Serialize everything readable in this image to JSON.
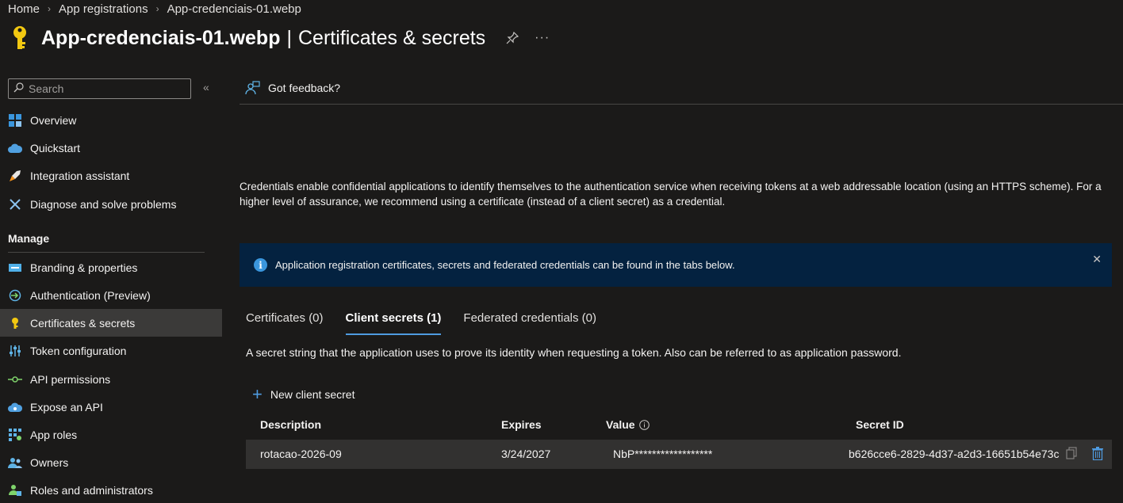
{
  "breadcrumb": {
    "home": "Home",
    "app_registrations": "App registrations",
    "current": "App-credenciais-01.webp"
  },
  "header": {
    "title_main": "App-credenciais-01.webp",
    "title_sep": "|",
    "title_sub": "Certificates & secrets",
    "more": "···"
  },
  "search": {
    "placeholder": "Search"
  },
  "sidebar": {
    "items": [
      {
        "label": "Overview"
      },
      {
        "label": "Quickstart"
      },
      {
        "label": "Integration assistant"
      },
      {
        "label": "Diagnose and solve problems"
      }
    ],
    "section_manage": "Manage",
    "manage_items": [
      {
        "label": "Branding & properties"
      },
      {
        "label": "Authentication (Preview)"
      },
      {
        "label": "Certificates & secrets"
      },
      {
        "label": "Token configuration"
      },
      {
        "label": "API permissions"
      },
      {
        "label": "Expose an API"
      },
      {
        "label": "App roles"
      },
      {
        "label": "Owners"
      },
      {
        "label": "Roles and administrators"
      }
    ]
  },
  "main": {
    "feedback": "Got feedback?",
    "description": "Credentials enable confidential applications to identify themselves to the authentication service when receiving tokens at a web addressable location (using an HTTPS scheme). For a higher level of assurance, we recommend using a certificate (instead of a client secret) as a credential.",
    "banner": "Application registration certificates, secrets and federated credentials can be found in the tabs below.",
    "tabs": [
      {
        "label": "Certificates (0)"
      },
      {
        "label": "Client secrets (1)"
      },
      {
        "label": "Federated credentials (0)"
      }
    ],
    "tab_description": "A secret string that the application uses to prove its identity when requesting a token. Also can be referred to as application password.",
    "new_secret": "New client secret",
    "table": {
      "headers": {
        "description": "Description",
        "expires": "Expires",
        "value": "Value",
        "secret_id": "Secret ID"
      },
      "rows": [
        {
          "description": "rotacao-2026-09",
          "expires": "3/24/2027",
          "value": "NbP******************",
          "secret_id": "b626cce6-2829-4d37-a2d3-16651b54e73c"
        }
      ]
    }
  },
  "colors": {
    "background": "#1b1a19",
    "accent": "#4f9be0",
    "banner": "#042240",
    "active_nav": "#3b3a39",
    "key_yellow": "#f2c811"
  }
}
